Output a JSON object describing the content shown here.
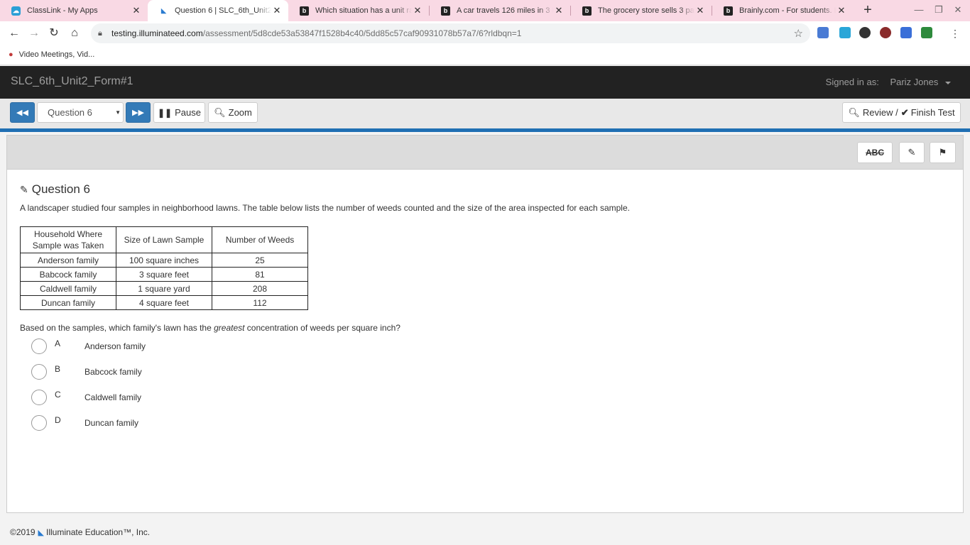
{
  "browser": {
    "tabs": [
      {
        "title": "ClassLink - My Apps",
        "icon": "classlink-icon",
        "active": false
      },
      {
        "title": "Question 6 | SLC_6th_Unit2_F",
        "icon": "illuminate-icon",
        "active": true
      },
      {
        "title": "Which situation has a unit ra",
        "icon": "brainly-icon",
        "active": false
      },
      {
        "title": "A car travels 126 miles in 3 h",
        "icon": "brainly-icon",
        "active": false
      },
      {
        "title": "The grocery store sells 3 pack",
        "icon": "brainly-icon",
        "active": false
      },
      {
        "title": "Brainly.com - For students. By",
        "icon": "brainly-icon",
        "active": false
      }
    ],
    "url_host": "testing.illuminateed.com",
    "url_path": "/assessment/5d8cde53a53847f1528b4c40/5dd85c57caf90931078b57a7/6?rldbqn=1",
    "bookmark": "Video Meetings, Vid..."
  },
  "app": {
    "title": "SLC_6th_Unit2_Form#1",
    "signed_in_label": "Signed in as:",
    "user": "Pariz Jones"
  },
  "controls": {
    "question_select": "Question 6",
    "pause_label": "Pause",
    "zoom_label": "Zoom",
    "review_label": "Review /",
    "finish_label": "Finish Test"
  },
  "tools": {
    "abc_label": "ABC"
  },
  "question": {
    "heading": "Question 6",
    "prompt": "A landscaper studied four samples in neighborhood lawns. The table below lists the number of weeds counted and the size of the area inspected for each sample.",
    "table": {
      "headers": [
        "Household Where Sample was Taken",
        "Size of Lawn Sample",
        "Number of Weeds"
      ],
      "rows": [
        [
          "Anderson family",
          "100 square inches",
          "25"
        ],
        [
          "Babcock family",
          "3 square feet",
          "81"
        ],
        [
          "Caldwell family",
          "1 square yard",
          "208"
        ],
        [
          "Duncan family",
          "4 square feet",
          "112"
        ]
      ]
    },
    "ask_before": "Based on the samples, which family's lawn has the ",
    "ask_emphasis": "greatest",
    "ask_after": " concentration of weeds per square inch?",
    "choices": [
      {
        "letter": "A",
        "text": "Anderson family"
      },
      {
        "letter": "B",
        "text": "Babcock family"
      },
      {
        "letter": "C",
        "text": "Caldwell family"
      },
      {
        "letter": "D",
        "text": "Duncan family"
      }
    ]
  },
  "footer": {
    "copyright": "©2019",
    "company": "Illuminate Education™, Inc."
  }
}
